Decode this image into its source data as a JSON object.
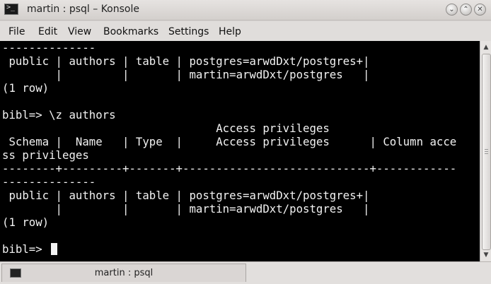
{
  "window": {
    "title": "martin : psql – Konsole",
    "icon": "terminal-icon",
    "buttons": {
      "minimize": "minimize-icon",
      "maximize": "maximize-icon",
      "close": "close-icon"
    }
  },
  "menubar": {
    "items": [
      "File",
      "Edit",
      "View",
      "Bookmarks",
      "Settings",
      "Help"
    ]
  },
  "terminal": {
    "lines": [
      "--------------",
      " public | authors | table | postgres=arwdDxt/postgres+|",
      "        |         |       | martin=arwdDxt/postgres   |",
      "(1 row)",
      "",
      "bibl=> \\z authors",
      "                                Access privileges",
      " Schema |  Name   | Type  |     Access privileges      | Column acce",
      "ss privileges",
      "--------+---------+-------+----------------------------+------------",
      "--------------",
      " public | authors | table | postgres=arwdDxt/postgres+|",
      "        |         |       | martin=arwdDxt/postgres   |",
      "(1 row)",
      "",
      "bibl=> "
    ]
  },
  "tabbar": {
    "tabs": [
      {
        "label": "martin : psql",
        "icon": "terminal-icon"
      }
    ]
  }
}
